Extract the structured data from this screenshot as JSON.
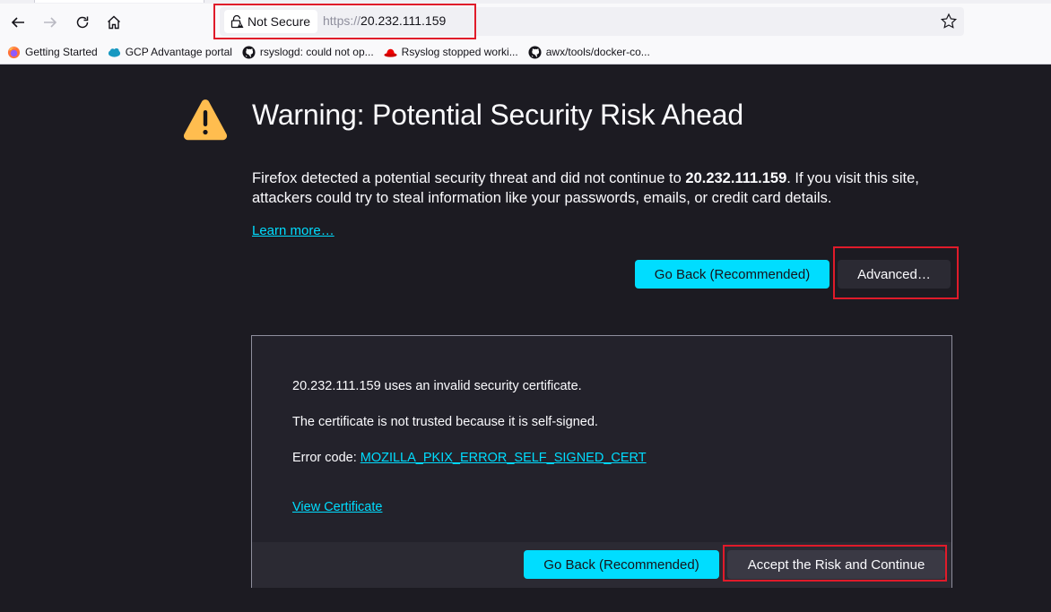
{
  "browser": {
    "nav": {
      "back_icon": "arrow-left-icon",
      "forward_icon": "arrow-right-icon",
      "reload_icon": "reload-icon",
      "home_icon": "home-icon"
    },
    "identity": {
      "icon": "broken-lock-warning-icon",
      "label": "Not Secure"
    },
    "url": {
      "scheme": "https://",
      "host": "20.232.111.159"
    },
    "bookmark_star_icon": "star-icon",
    "bookmarks": [
      {
        "icon": "firefox-icon",
        "label": "Getting Started"
      },
      {
        "icon": "salesforce-cloud-icon",
        "label": "GCP Advantage portal"
      },
      {
        "icon": "github-icon",
        "label": "rsyslogd: could not op..."
      },
      {
        "icon": "redhat-icon",
        "label": "Rsyslog stopped worki..."
      },
      {
        "icon": "github-icon",
        "label": "awx/tools/docker-co..."
      }
    ]
  },
  "page": {
    "warning_icon": "warning-triangle-icon",
    "title": "Warning: Potential Security Risk Ahead",
    "intro_before": "Firefox detected a potential security threat and did not continue to ",
    "intro_host": "20.232.111.159",
    "intro_after": ". If you visit this site, attackers could try to steal information like your passwords, emails, or credit card details.",
    "learn_more": "Learn more…",
    "go_back_label": "Go Back (Recommended)",
    "advanced_label": "Advanced…",
    "advanced_panel": {
      "line1": "20.232.111.159 uses an invalid security certificate.",
      "line2": "The certificate is not trusted because it is self-signed.",
      "error_prefix": "Error code: ",
      "error_code": "MOZILLA_PKIX_ERROR_SELF_SIGNED_CERT",
      "view_certificate": "View Certificate",
      "go_back_label": "Go Back (Recommended)",
      "accept_label": "Accept the Risk and Continue"
    }
  },
  "colors": {
    "accent": "#00ddff",
    "page_bg": "#1c1b22",
    "panel_bg": "#23222b",
    "warning": "#ffbd4f",
    "highlight": "#e01b2a"
  }
}
